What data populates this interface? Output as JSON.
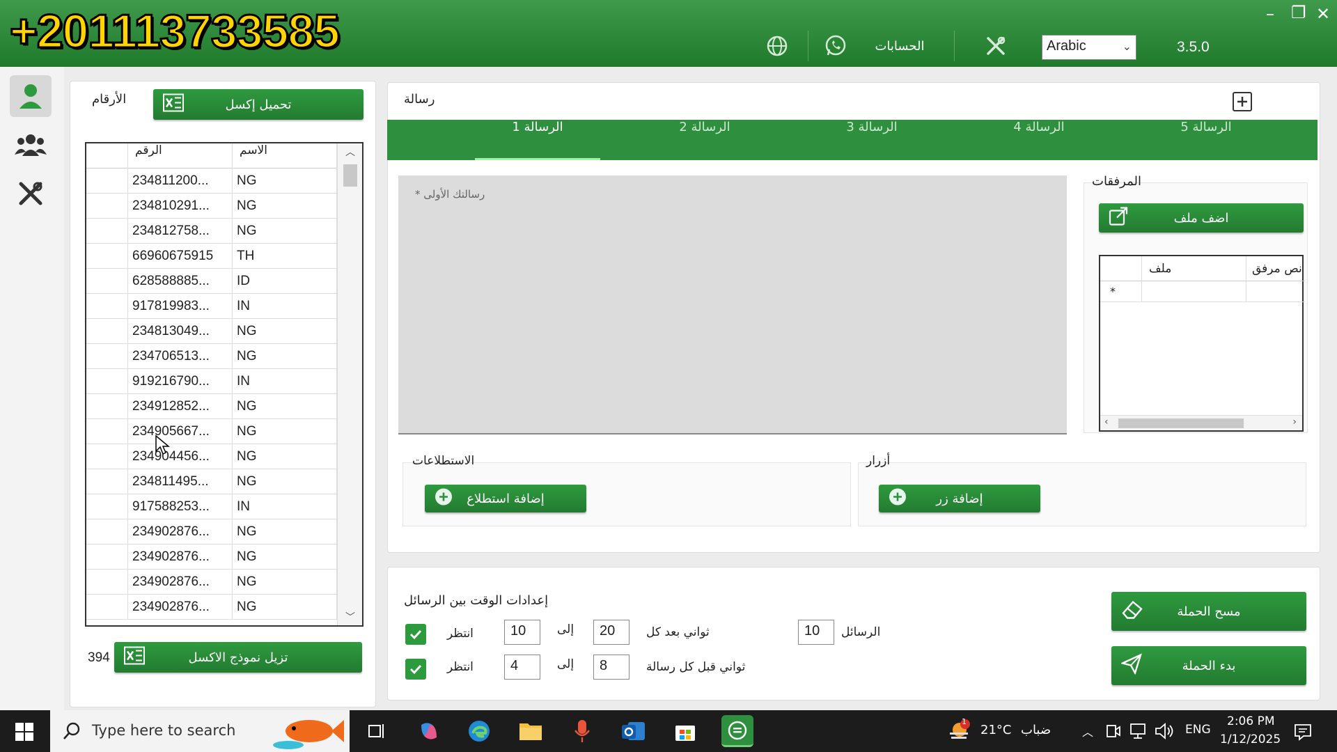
{
  "overlay": {
    "phone_text": "+201113733585"
  },
  "topbar": {
    "accounts_label": "الحسابات",
    "language": "Arabic",
    "version": "3.5.0",
    "icons": [
      "globe-icon",
      "whatsapp-icon",
      "tools-icon"
    ]
  },
  "window_controls": {
    "minimize": "–",
    "restore": "❐",
    "close": "✕"
  },
  "left_panel": {
    "title": "الأرقام",
    "upload_excel_label": "تحميل إكسل",
    "columns": {
      "number": "الرقم",
      "name": "الاسم"
    },
    "rows": [
      {
        "number": "234811200...",
        "name": "NG"
      },
      {
        "number": "234810291...",
        "name": "NG"
      },
      {
        "number": "234812758...",
        "name": "NG"
      },
      {
        "number": "66960675915",
        "name": "TH"
      },
      {
        "number": "628588885...",
        "name": "ID"
      },
      {
        "number": "917819983...",
        "name": "IN"
      },
      {
        "number": "234813049...",
        "name": "NG"
      },
      {
        "number": "234706513...",
        "name": "NG"
      },
      {
        "number": "919216790...",
        "name": "IN"
      },
      {
        "number": "234912852...",
        "name": "NG"
      },
      {
        "number": "234905667...",
        "name": "NG"
      },
      {
        "number": "234904456...",
        "name": "NG"
      },
      {
        "number": "234811495...",
        "name": "NG"
      },
      {
        "number": "917588253...",
        "name": "IN"
      },
      {
        "number": "234902876...",
        "name": "NG"
      },
      {
        "number": "234902876...",
        "name": "NG"
      },
      {
        "number": "234902876...",
        "name": "NG"
      },
      {
        "number": "234902876...",
        "name": "NG"
      }
    ],
    "download_template_label": "تزيل نموذج الاكسل",
    "count": "394"
  },
  "message_panel": {
    "title": "رسالة",
    "tabs": [
      "الرسالة 1",
      "الرسالة 2",
      "الرسالة 3",
      "الرسالة 4",
      "الرسالة 5"
    ],
    "active_tab": 0,
    "placeholder": "* رسالتك الأولى",
    "attachments": {
      "title": "المرفقات",
      "add_file_label": "اضف ملف",
      "col_file": "ملف",
      "col_text": "نص مرفق",
      "new_row_marker": "*"
    },
    "polls": {
      "title": "الاستطلاعات",
      "add_label": "إضافة استطلاع"
    },
    "buttons": {
      "title": "أزرار",
      "add_label": "إضافة زر"
    }
  },
  "timing_panel": {
    "title": "إعدادات الوقت بين الرسائل",
    "row1": {
      "wait_label": "انتظر",
      "from": "10",
      "to_label": "إلى",
      "to": "20",
      "seconds_label": "ثواني بعد كل",
      "messages": "10",
      "messages_label": "الرسائل",
      "checked": true
    },
    "row2": {
      "wait_label": "انتظر",
      "from": "4",
      "to_label": "إلى",
      "to": "8",
      "seconds_label": "ثواني قبل كل رسالة",
      "checked": true
    },
    "clear_label": "مسح الحملة",
    "start_label": "بدء الحملة"
  },
  "taskbar": {
    "search_placeholder": "Type here to search",
    "weather": "21°C",
    "weather_text": "ضباب",
    "lang": "ENG",
    "time": "2:06 PM",
    "date": "1/12/2025",
    "notification_badge": "1"
  },
  "colors": {
    "brand_green": "#2e8f3e",
    "topbar": "#2f8a3c"
  }
}
